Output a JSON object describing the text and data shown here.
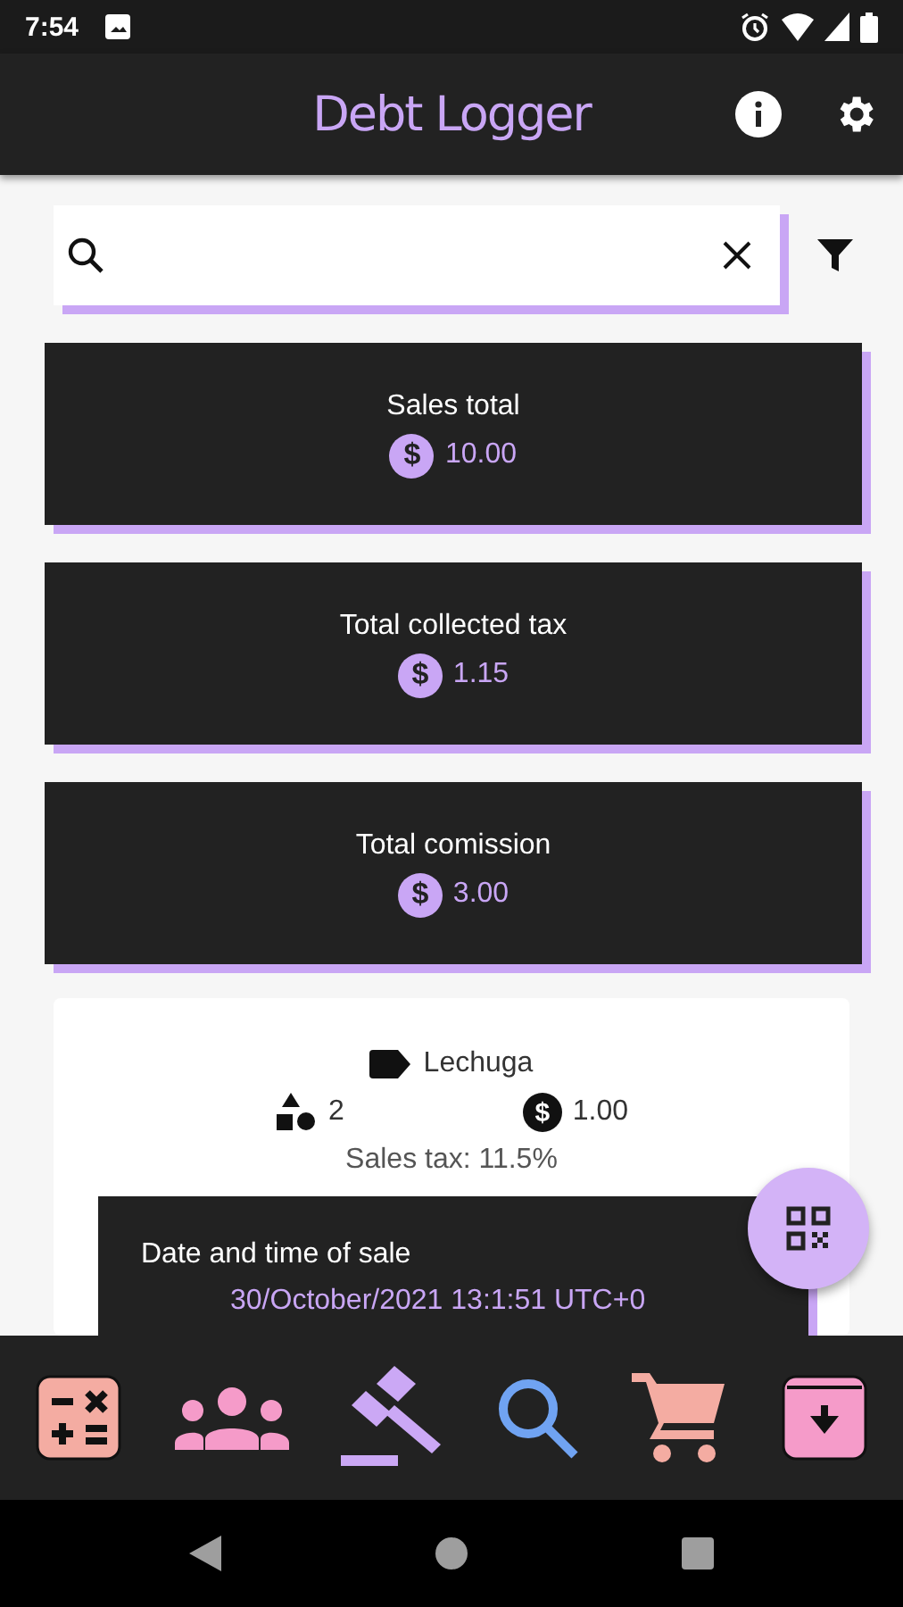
{
  "status_bar": {
    "time": "7:54"
  },
  "app_bar": {
    "title": "Debt Logger"
  },
  "summary_cards": [
    {
      "label": "Sales total",
      "symbol": "$",
      "amount": "10.00"
    },
    {
      "label": "Total collected tax",
      "symbol": "$",
      "amount": "1.15"
    },
    {
      "label": "Total comission",
      "symbol": "$",
      "amount": "3.00"
    }
  ],
  "sale": {
    "product": "Lechuga",
    "quantity": "2",
    "symbol": "$",
    "price": "1.00",
    "tax": "Sales tax: 11.5%",
    "date_label": "Date and time of sale",
    "date": "30/October/2021 13:1:51 UTC+0"
  },
  "bottom_nav": [
    {
      "kind": "calculator",
      "color": "#f4aca2"
    },
    {
      "kind": "people",
      "color": "#f59bc9"
    },
    {
      "kind": "gavel",
      "color": "#cba8f5"
    },
    {
      "kind": "search",
      "color": "#70a3f2"
    },
    {
      "kind": "cart",
      "color": "#f4aca2"
    },
    {
      "kind": "archive",
      "color": "#f59bc9"
    }
  ]
}
